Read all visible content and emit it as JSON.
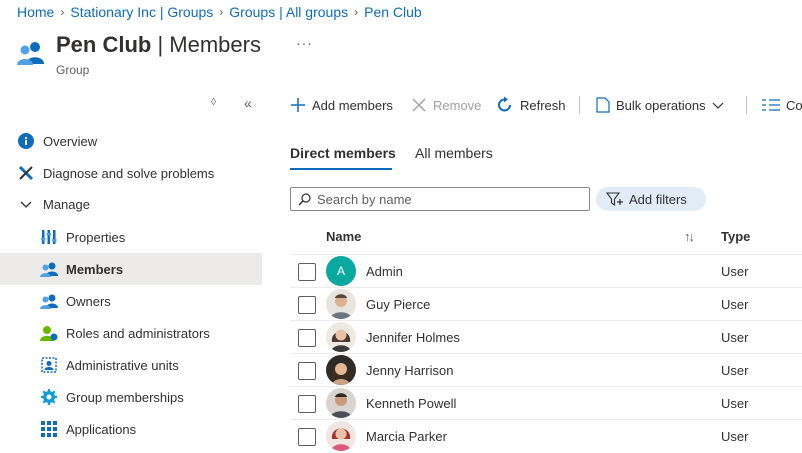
{
  "breadcrumb": [
    "Home",
    "Stationary Inc | Groups",
    "Groups | All groups",
    "Pen Club"
  ],
  "header": {
    "title_main": "Pen Club",
    "title_rest": " | Members",
    "subtitle": "Group",
    "more": "···"
  },
  "sidebar": {
    "items": [
      {
        "label": "Overview"
      },
      {
        "label": "Diagnose and solve problems"
      },
      {
        "label": "Manage"
      },
      {
        "label": "Properties"
      },
      {
        "label": "Members"
      },
      {
        "label": "Owners"
      },
      {
        "label": "Roles and administrators"
      },
      {
        "label": "Administrative units"
      },
      {
        "label": "Group memberships"
      },
      {
        "label": "Applications"
      }
    ]
  },
  "toolbar": {
    "add_members": "Add members",
    "remove": "Remove",
    "refresh": "Refresh",
    "bulk": "Bulk operations",
    "columns": "Co"
  },
  "tabs": {
    "direct": "Direct members",
    "all": "All members"
  },
  "search": {
    "placeholder": "Search by name"
  },
  "filters": {
    "label": "Add filters"
  },
  "table": {
    "headers": {
      "name": "Name",
      "type": "Type"
    },
    "rows": [
      {
        "initial": "A",
        "name": "Admin",
        "type": "User"
      },
      {
        "initial": "",
        "name": "Guy Pierce",
        "type": "User"
      },
      {
        "initial": "",
        "name": "Jennifer Holmes",
        "type": "User"
      },
      {
        "initial": "",
        "name": "Jenny Harrison",
        "type": "User"
      },
      {
        "initial": "",
        "name": "Kenneth Powell",
        "type": "User"
      },
      {
        "initial": "",
        "name": "Marcia Parker",
        "type": "User"
      }
    ]
  },
  "colors": {
    "accent": "#0f6cbd",
    "admin_avatar": "#0aa89e",
    "selected_bg": "#edebe9"
  }
}
